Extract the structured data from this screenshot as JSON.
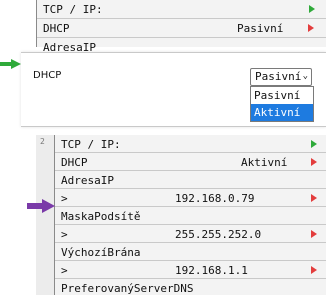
{
  "top": {
    "header": "TCP / IP:",
    "dhcp_label": "DHCP",
    "dhcp_value": "Pasivní",
    "cut_label": "AdresaIP"
  },
  "dropdown": {
    "label": "DHCP",
    "selected_value": "Pasivní",
    "chevron": "⌄",
    "options": [
      "Pasivní",
      "Aktivní"
    ],
    "highlighted_option": "Aktivní"
  },
  "bottom": {
    "line_number": "2",
    "header": "TCP / IP:",
    "dhcp_label": "DHCP",
    "dhcp_value": "Aktivní",
    "rows": [
      {
        "label": "AdresaIP"
      },
      {
        "prefix": ">",
        "value": "192.168.0.79"
      },
      {
        "label": "MaskaPodsítě"
      },
      {
        "prefix": ">",
        "value": "255.255.252.0"
      },
      {
        "label": "VýchozíBrána"
      },
      {
        "prefix": ">",
        "value": "192.168.1.1"
      },
      {
        "label": "PreferovanýServerDNS"
      }
    ]
  },
  "colors": {
    "accent_green": "#2faa3a",
    "accent_red": "#e33d3d",
    "accent_purple": "#7a3aa8",
    "selection_blue": "#1e7be0"
  }
}
